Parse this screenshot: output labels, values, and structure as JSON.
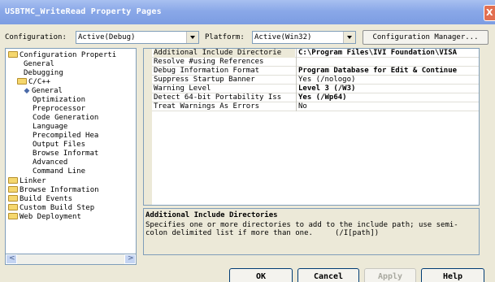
{
  "window": {
    "title": "USBTMC_WriteRead Property Pages",
    "close_glyph": "X"
  },
  "config_bar": {
    "configuration_label": "Configuration:",
    "configuration_value": "Active(Debug)",
    "platform_label": "Platform:",
    "platform_value": "Active(Win32)",
    "manager_button": "Configuration Manager..."
  },
  "tree": {
    "items": [
      {
        "label": "Configuration Properti",
        "icon": "folder-open-icon"
      },
      {
        "label": "General",
        "icon": ""
      },
      {
        "label": "Debugging",
        "icon": ""
      },
      {
        "label": "C/C++",
        "icon": "folder-open-icon"
      },
      {
        "label": "General",
        "icon": "bullet-icon"
      },
      {
        "label": "Optimization",
        "icon": ""
      },
      {
        "label": "Preprocessor",
        "icon": ""
      },
      {
        "label": "Code Generation",
        "icon": ""
      },
      {
        "label": "Language",
        "icon": ""
      },
      {
        "label": "Precompiled Hea",
        "icon": ""
      },
      {
        "label": "Output Files",
        "icon": ""
      },
      {
        "label": "Browse Informat",
        "icon": ""
      },
      {
        "label": "Advanced",
        "icon": ""
      },
      {
        "label": "Command Line",
        "icon": ""
      },
      {
        "label": "Linker",
        "icon": "folder-icon"
      },
      {
        "label": "Browse Information",
        "icon": "folder-icon"
      },
      {
        "label": "Build Events",
        "icon": "folder-icon"
      },
      {
        "label": "Custom Build Step",
        "icon": "folder-icon"
      },
      {
        "label": "Web Deployment",
        "icon": "folder-icon"
      }
    ]
  },
  "properties": {
    "rows": [
      {
        "name": "Additional Include Directorie",
        "value": "C:\\Program Files\\IVI Foundation\\VISA",
        "bold": true
      },
      {
        "name": "Resolve #using References",
        "value": "",
        "bold": false
      },
      {
        "name": "Debug Information Format",
        "value": "Program Database for Edit & Continue",
        "bold": true
      },
      {
        "name": "Suppress Startup Banner",
        "value": "Yes (/nologo)",
        "bold": false
      },
      {
        "name": "Warning Level",
        "value": "Level 3 (/W3)",
        "bold": true
      },
      {
        "name": "Detect 64-bit Portability Iss",
        "value": "Yes (/Wp64)",
        "bold": true
      },
      {
        "name": "Treat Warnings As Errors",
        "value": "No",
        "bold": false
      }
    ]
  },
  "description": {
    "title": "Additional Include Directories",
    "line1": "Specifies one or more directories to add to the include path; use semi-",
    "line2": "colon delimited list if more than one.     (/I[path])"
  },
  "buttons": {
    "ok": "OK",
    "cancel": "Cancel",
    "apply": "Apply",
    "help": "Help"
  },
  "colors": {
    "title_gradient": "#8aa8e8",
    "window_bg": "#ece9d8",
    "close_button": "#e26f51"
  }
}
